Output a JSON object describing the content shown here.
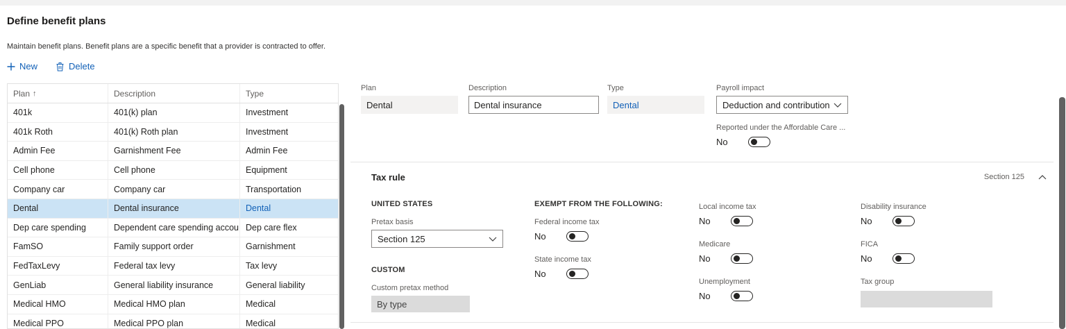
{
  "page": {
    "title": "Define benefit plans",
    "subtitle": "Maintain benefit plans. Benefit plans are a specific benefit that a provider is contracted to offer."
  },
  "toolbar": {
    "new": "New",
    "delete": "Delete"
  },
  "table": {
    "columns": [
      "Plan",
      "Description",
      "Type"
    ],
    "sort_column": "Plan",
    "sort_direction": "ascending",
    "rows": [
      {
        "plan": "401k",
        "description": "401(k) plan",
        "type": "Investment"
      },
      {
        "plan": "401k Roth",
        "description": "401(k) Roth plan",
        "type": "Investment"
      },
      {
        "plan": "Admin Fee",
        "description": "Garnishment Fee",
        "type": "Admin Fee"
      },
      {
        "plan": "Cell phone",
        "description": "Cell phone",
        "type": "Equipment"
      },
      {
        "plan": "Company car",
        "description": "Company car",
        "type": "Transportation"
      },
      {
        "plan": "Dental",
        "description": "Dental insurance",
        "type": "Dental",
        "selected": true
      },
      {
        "plan": "Dep care spending",
        "description": "Dependent care spending accou...",
        "type": "Dep care flex"
      },
      {
        "plan": "FamSO",
        "description": "Family support order",
        "type": "Garnishment"
      },
      {
        "plan": "FedTaxLevy",
        "description": "Federal tax levy",
        "type": "Tax levy"
      },
      {
        "plan": "GenLiab",
        "description": "General liability insurance",
        "type": "General liability"
      },
      {
        "plan": "Medical HMO",
        "description": "Medical HMO plan",
        "type": "Medical"
      },
      {
        "plan": "Medical PPO",
        "description": "Medical PPO plan",
        "type": "Medical"
      }
    ]
  },
  "details": {
    "plan": {
      "label": "Plan",
      "value": "Dental"
    },
    "description": {
      "label": "Description",
      "value": "Dental insurance"
    },
    "type": {
      "label": "Type",
      "value": "Dental"
    },
    "payroll_impact": {
      "label": "Payroll impact",
      "value": "Deduction and contribution"
    },
    "aca": {
      "label": "Reported under the Affordable Care ...",
      "value": "No"
    }
  },
  "tax_rule": {
    "title": "Tax rule",
    "summary": "Section 125",
    "us_heading": "UNITED STATES",
    "pretax_basis": {
      "label": "Pretax basis",
      "value": "Section 125"
    },
    "custom_heading": "CUSTOM",
    "custom_pretax_method": {
      "label": "Custom pretax method",
      "value": "By type"
    },
    "exempt_heading": "EXEMPT FROM THE FOLLOWING:",
    "federal_income_tax": {
      "label": "Federal income tax",
      "value": "No"
    },
    "state_income_tax": {
      "label": "State income tax",
      "value": "No"
    },
    "local_income_tax": {
      "label": "Local income tax",
      "value": "No"
    },
    "medicare": {
      "label": "Medicare",
      "value": "No"
    },
    "unemployment": {
      "label": "Unemployment",
      "value": "No"
    },
    "disability_insurance": {
      "label": "Disability insurance",
      "value": "No"
    },
    "fica": {
      "label": "FICA",
      "value": "No"
    },
    "tax_group": {
      "label": "Tax group",
      "value": ""
    }
  },
  "colors": {
    "accent_blue": "#1160b7",
    "selected_row": "#cbe3f5",
    "label_gray": "#605e5c"
  }
}
